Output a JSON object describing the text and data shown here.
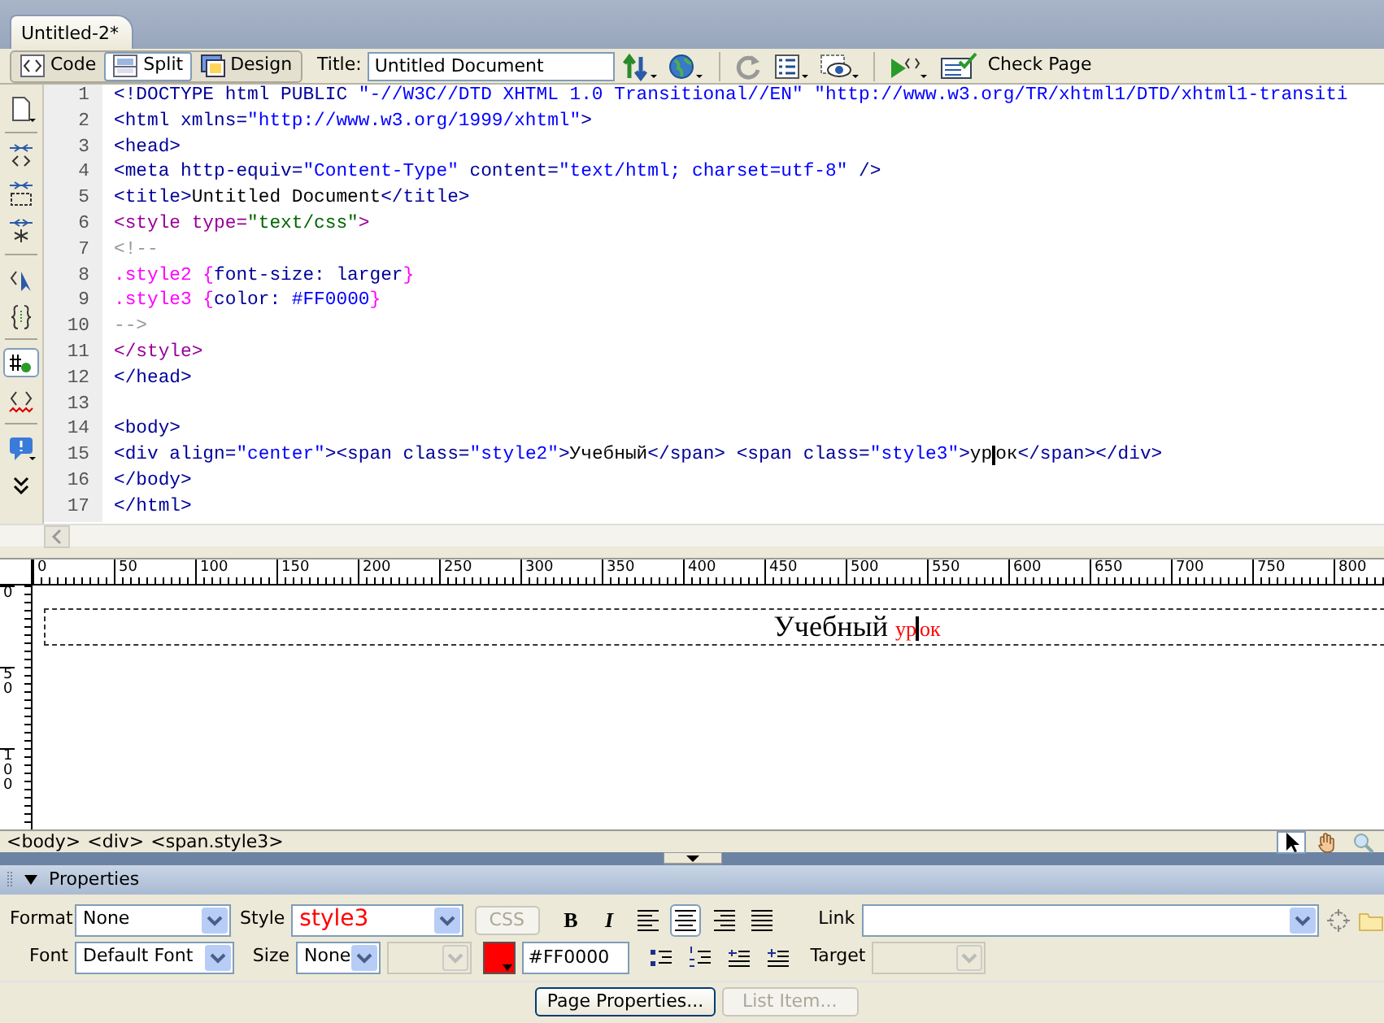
{
  "document_tab": {
    "title": "Untitled-2*",
    "selected": true
  },
  "toolbar": {
    "view_buttons": [
      {
        "label": "Code",
        "kind": "code",
        "selected": false
      },
      {
        "label": "Split",
        "kind": "split",
        "selected": true
      },
      {
        "label": "Design",
        "kind": "design",
        "selected": false
      }
    ],
    "title_label": "Title:",
    "title_value": "Untitled Document",
    "check_page": "Check Page"
  },
  "code": {
    "lines": [
      {
        "number": "1",
        "segments": [
          {
            "kind": "tag",
            "text": "<!DOCTYPE html PUBLIC "
          },
          {
            "kind": "value",
            "text": "\"-//W3C//DTD XHTML 1.0 Transitional//EN\" \"http://www.w3.org/TR/xhtml1/DTD/xhtml1-transiti"
          }
        ]
      },
      {
        "number": "2",
        "segments": [
          {
            "kind": "tag",
            "text": "<html xmlns="
          },
          {
            "kind": "value",
            "text": "\"http://www.w3.org/1999/xhtml\""
          },
          {
            "kind": "tag",
            "text": ">"
          }
        ]
      },
      {
        "number": "3",
        "segments": [
          {
            "kind": "tag",
            "text": "<head>"
          }
        ]
      },
      {
        "number": "4",
        "segments": [
          {
            "kind": "tag",
            "text": "<meta http-equiv="
          },
          {
            "kind": "value",
            "text": "\"Content-Type\""
          },
          {
            "kind": "tag",
            "text": " content="
          },
          {
            "kind": "value",
            "text": "\"text/html; charset=utf-8\""
          },
          {
            "kind": "tag",
            "text": " />"
          }
        ]
      },
      {
        "number": "5",
        "segments": [
          {
            "kind": "tag",
            "text": "<title>"
          },
          {
            "kind": "text",
            "text": "Untitled Document"
          },
          {
            "kind": "tag",
            "text": "</title>"
          }
        ]
      },
      {
        "number": "6",
        "segments": [
          {
            "kind": "style-tag",
            "text": "<style type="
          },
          {
            "kind": "style-value",
            "text": "\"text/css\""
          },
          {
            "kind": "style-tag",
            "text": ">"
          }
        ]
      },
      {
        "number": "7",
        "segments": [
          {
            "kind": "comment",
            "text": "<!--"
          }
        ]
      },
      {
        "number": "8",
        "segments": [
          {
            "kind": "selector",
            "text": ".style2 {"
          },
          {
            "kind": "property",
            "text": "font-size: larger"
          },
          {
            "kind": "selector",
            "text": "}"
          }
        ]
      },
      {
        "number": "9",
        "segments": [
          {
            "kind": "selector",
            "text": ".style3 {"
          },
          {
            "kind": "property",
            "text": "color: "
          },
          {
            "kind": "css-value",
            "text": "#FF0000"
          },
          {
            "kind": "selector",
            "text": "}"
          }
        ]
      },
      {
        "number": "10",
        "segments": [
          {
            "kind": "comment",
            "text": "-->"
          }
        ]
      },
      {
        "number": "11",
        "segments": [
          {
            "kind": "style-tag",
            "text": "</style>"
          }
        ]
      },
      {
        "number": "12",
        "segments": [
          {
            "kind": "tag",
            "text": "</head>"
          }
        ]
      },
      {
        "number": "13"
      },
      {
        "number": "14",
        "segments": [
          {
            "kind": "tag",
            "text": "<body>"
          }
        ]
      },
      {
        "number": "15",
        "segments": [
          {
            "kind": "tag",
            "text": "<div align="
          },
          {
            "kind": "value",
            "text": "\"center\""
          },
          {
            "kind": "tag",
            "text": "><span class="
          },
          {
            "kind": "value",
            "text": "\"style2\""
          },
          {
            "kind": "tag",
            "text": ">"
          },
          {
            "kind": "text",
            "text": "Учебный"
          },
          {
            "kind": "tag",
            "text": "</span> <span class="
          },
          {
            "kind": "value",
            "text": "\"style3\""
          },
          {
            "kind": "tag",
            "text": ">"
          },
          {
            "kind": "text",
            "text": "ур"
          },
          {
            "kind": "text",
            "text": "ок",
            "caret_before": true
          },
          {
            "kind": "tag",
            "text": "</span></div>"
          }
        ]
      },
      {
        "number": "16",
        "segments": [
          {
            "kind": "tag",
            "text": "</body>"
          }
        ]
      },
      {
        "number": "17",
        "segments": [
          {
            "kind": "tag",
            "text": "</html>"
          }
        ]
      }
    ]
  },
  "ruler": {
    "marks": [
      "0",
      "50",
      "100",
      "150",
      "200",
      "250",
      "300",
      "350",
      "400",
      "450",
      "500",
      "550",
      "600",
      "650",
      "700",
      "750",
      "800"
    ]
  },
  "vertical_ruler": {
    "marks": [
      "0",
      "50",
      "100"
    ]
  },
  "design": {
    "segments": [
      {
        "kind": "style2",
        "text": "Учебный "
      },
      {
        "kind": "style3",
        "text": "ур"
      },
      {
        "kind": "style3",
        "text": "ок",
        "caret_before": true
      }
    ]
  },
  "tag_selector": [
    "<body>",
    "<div>",
    "<span.style3>"
  ],
  "view_tools": [
    {
      "kind": "pointer",
      "selected": true
    },
    {
      "kind": "hand",
      "selected": false
    },
    {
      "kind": "zoom",
      "selected": false
    }
  ],
  "properties": {
    "title": "Properties",
    "expanded": true,
    "format": {
      "label": "Format",
      "value": "None"
    },
    "style": {
      "label": "Style",
      "value": "style3"
    },
    "css_button": {
      "label": "CSS",
      "disabled": true
    },
    "bold": "B",
    "italic": "I",
    "align_buttons": [
      {
        "kind": "left",
        "selected": false
      },
      {
        "kind": "center",
        "selected": true
      },
      {
        "kind": "right",
        "selected": false
      },
      {
        "kind": "justify",
        "selected": false
      }
    ],
    "link": {
      "label": "Link"
    },
    "font": {
      "label": "Font",
      "value": "Default Font"
    },
    "size": {
      "label": "Size",
      "value": "None"
    },
    "text_color": {
      "value": "#FF0000",
      "color": "#ff0000"
    },
    "list_buttons": [
      {
        "kind": "unordered"
      },
      {
        "kind": "ordered"
      },
      {
        "kind": "outdent"
      },
      {
        "kind": "indent"
      }
    ],
    "target": {
      "label": "Target",
      "disabled": true
    },
    "buttons": [
      {
        "label": "Page Properties...",
        "disabled": false
      },
      {
        "label": "List Item...",
        "disabled": true
      }
    ]
  }
}
